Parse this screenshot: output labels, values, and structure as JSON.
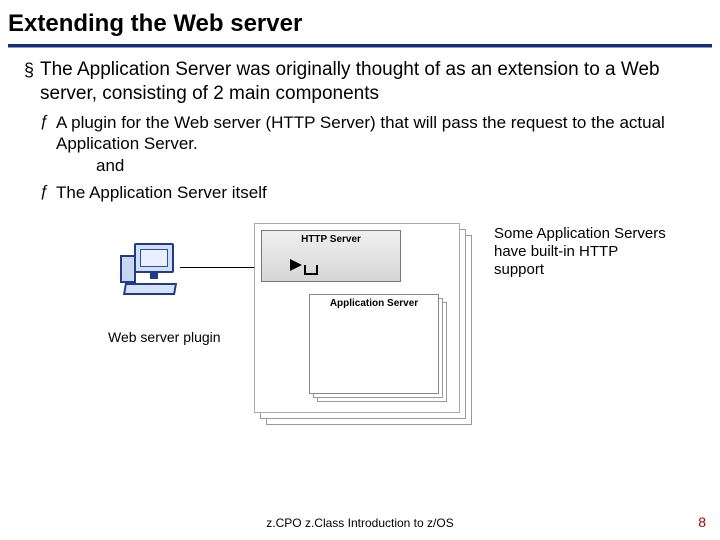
{
  "title": "Extending the Web server",
  "bullets": {
    "main": "The Application Server was originally thought of as an extension to a Web server, consisting of 2 main components",
    "sub1": "A plugin for the Web server (HTTP Server) that will pass the request to the actual Application Server.",
    "conj": "and",
    "sub2": "The Application Server itself"
  },
  "diagram": {
    "http_label": "HTTP Server",
    "app_label": "Application Server",
    "plugin_label": "Web server plugin",
    "side_note": "Some Application Servers have built-in HTTP support"
  },
  "footer": "z.CPO z.Class  Introduction to z/OS",
  "page": "8"
}
